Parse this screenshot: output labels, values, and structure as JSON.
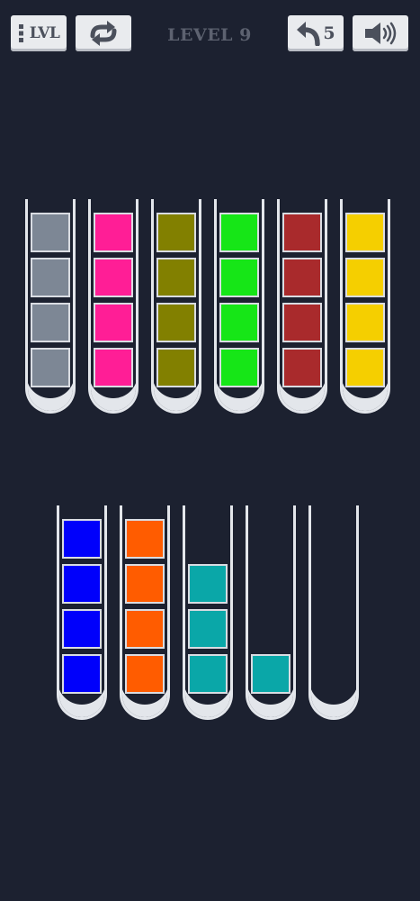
{
  "header": {
    "level_button_label": "LVL",
    "level_title": "LEVEL 9",
    "undo_count": "5"
  },
  "icons": {
    "level_menu": "level-menu-icon",
    "restart": "restart-icon",
    "undo": "undo-icon",
    "sound": "sound-icon"
  },
  "colors": {
    "background": "#1c2130",
    "button_bg": "#e9ebee",
    "tube_glass": "#e3e6eb"
  },
  "tubes": [
    {
      "blocks": [
        "#7d8795",
        "#7d8795",
        "#7d8795",
        "#7d8795"
      ]
    },
    {
      "blocks": [
        "#ff1e96",
        "#ff1e96",
        "#ff1e96",
        "#ff1e96"
      ]
    },
    {
      "blocks": [
        "#828000",
        "#828000",
        "#828000",
        "#828000"
      ]
    },
    {
      "blocks": [
        "#16e617",
        "#16e617",
        "#16e617",
        "#16e617"
      ]
    },
    {
      "blocks": [
        "#a92a2c",
        "#a92a2c",
        "#a92a2c",
        "#a92a2c"
      ]
    },
    {
      "blocks": [
        "#f5cf00",
        "#f5cf00",
        "#f5cf00",
        "#f5cf00"
      ]
    },
    {
      "blocks": [
        "#0000fb",
        "#0000fb",
        "#0000fb",
        "#0000fb"
      ]
    },
    {
      "blocks": [
        "#ff5c00",
        "#ff5c00",
        "#ff5c00",
        "#ff5c00"
      ]
    },
    {
      "blocks": [
        "#0aa7a8",
        "#0aa7a8",
        "#0aa7a8"
      ]
    },
    {
      "blocks": [
        "#0aa7a8"
      ]
    },
    {
      "blocks": []
    }
  ]
}
